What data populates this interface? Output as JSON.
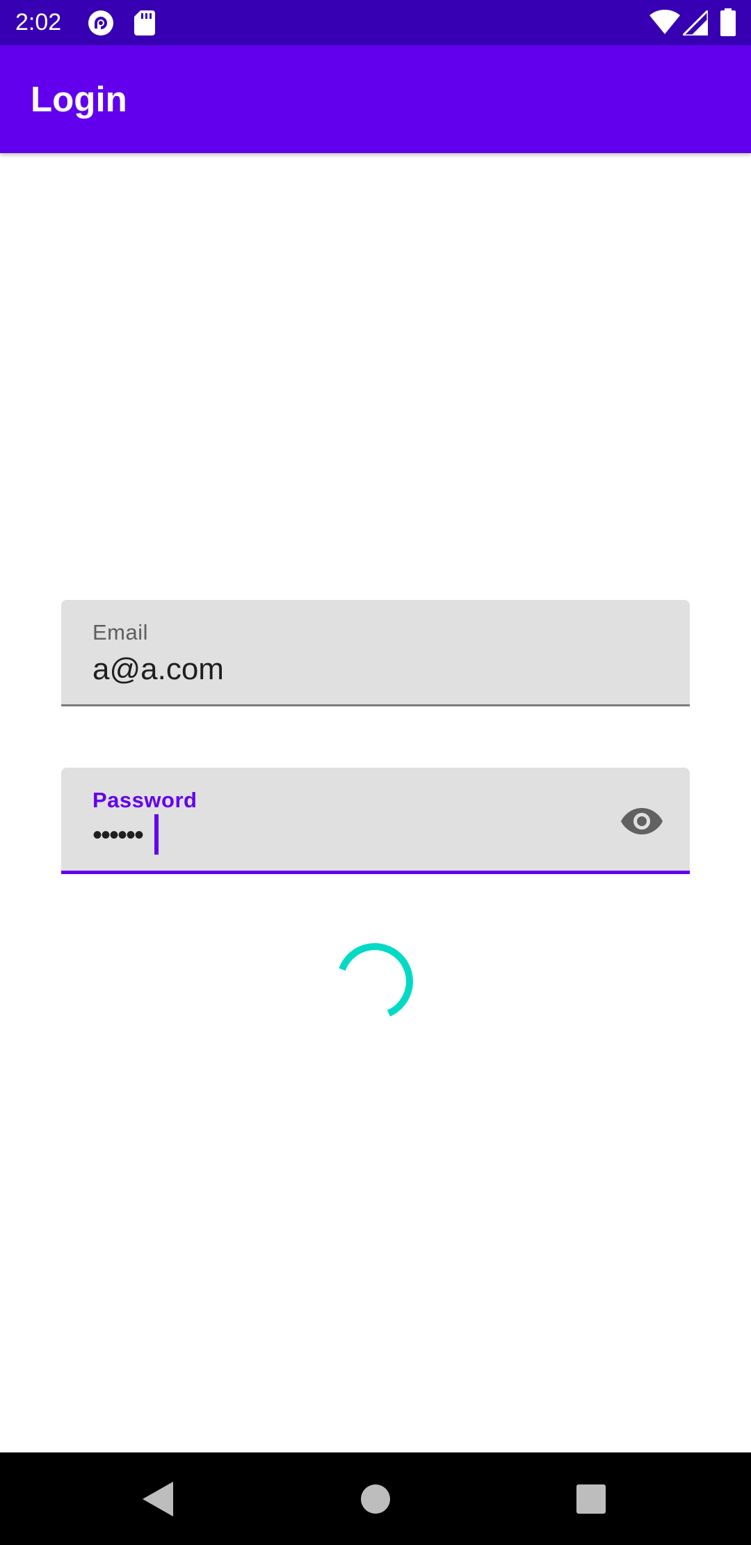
{
  "status_bar": {
    "time": "2:02",
    "icons": [
      "pocket-casts-icon",
      "sd-card-icon",
      "wifi-icon",
      "cellular-signal-icon",
      "battery-icon"
    ],
    "background": "#3700B3"
  },
  "app_bar": {
    "title": "Login",
    "background": "#6200EE"
  },
  "form": {
    "email": {
      "label": "Email",
      "value": "a@a.com"
    },
    "password": {
      "label": "Password",
      "value": "••••••",
      "toggle_icon": "eye-icon",
      "focused": true
    }
  },
  "loading": {
    "indicator": "circular-progress",
    "color": "#03DAC5"
  },
  "nav_bar": {
    "buttons": [
      "back-icon",
      "home-icon",
      "recents-icon"
    ]
  },
  "colors": {
    "primary": "#6200EE",
    "primary_dark": "#3700B3",
    "secondary": "#03DAC5",
    "field_fill": "#E0E0E0"
  }
}
